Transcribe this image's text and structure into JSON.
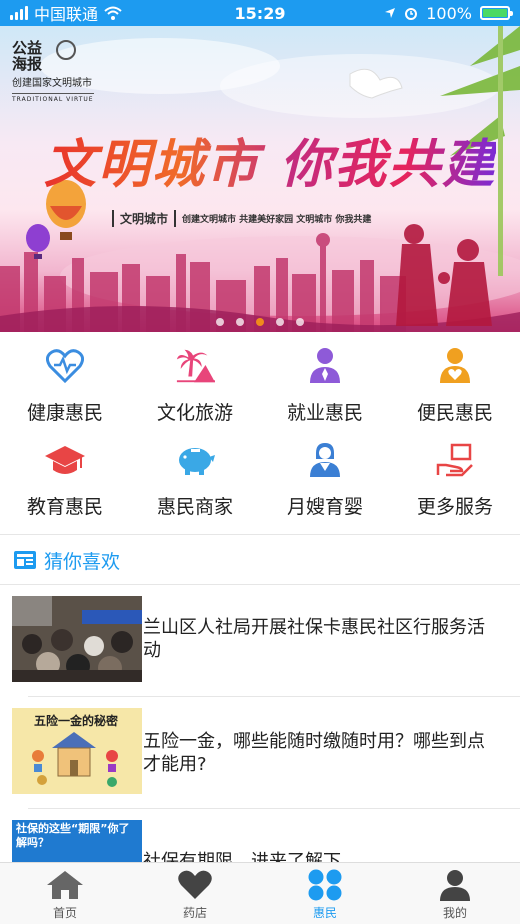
{
  "status": {
    "carrier": "中国联通",
    "time": "15:29",
    "battery": "100%"
  },
  "banner": {
    "brand_line1": "公益海报",
    "brand_line2": "创建国家文明城市",
    "brand_line3": "TRADITIONAL VIRTUE",
    "headline": "文明城市 你我共建",
    "sub_label": "文明城市",
    "tagline": "创建文明城市 共建美好家园 文明城市 你我共建",
    "active_slide": 3
  },
  "services": [
    {
      "label": "健康惠民",
      "icon": "heart-pulse-icon",
      "color": "#3b8de0"
    },
    {
      "label": "文化旅游",
      "icon": "palm-tree-icon",
      "color": "#e8457a"
    },
    {
      "label": "就业惠民",
      "icon": "worker-icon",
      "color": "#8e5ad8"
    },
    {
      "label": "便民惠民",
      "icon": "person-heart-icon",
      "color": "#f0a020"
    },
    {
      "label": "教育惠民",
      "icon": "graduation-cap-icon",
      "color": "#e84545"
    },
    {
      "label": "惠民商家",
      "icon": "piggy-bank-icon",
      "color": "#3aa8e6"
    },
    {
      "label": "月嫂育婴",
      "icon": "nanny-icon",
      "color": "#3b7fd4"
    },
    {
      "label": "更多服务",
      "icon": "hand-box-icon",
      "color": "#e84545"
    }
  ],
  "section": {
    "title": "猜你喜欢",
    "icon": "news-icon"
  },
  "news": [
    {
      "title": "兰山区人社局开展社保卡惠民社区行服务活动"
    },
    {
      "title": "五险一金，哪些能随时缴随时用？哪些到点才能用?",
      "thumb_text": "五险一金的秘密"
    },
    {
      "title": "社保有期限，进来了解下",
      "thumb_text": "社保的这些“期限”你了解吗？"
    }
  ],
  "tabs": [
    {
      "label": "首页",
      "icon": "home-icon"
    },
    {
      "label": "药店",
      "icon": "heart-icon"
    },
    {
      "label": "惠民",
      "icon": "grid-circles-icon",
      "active": true
    },
    {
      "label": "我的",
      "icon": "user-icon"
    }
  ],
  "colors": {
    "accent": "#1d9bf0",
    "inactive_tab": "#555555"
  }
}
